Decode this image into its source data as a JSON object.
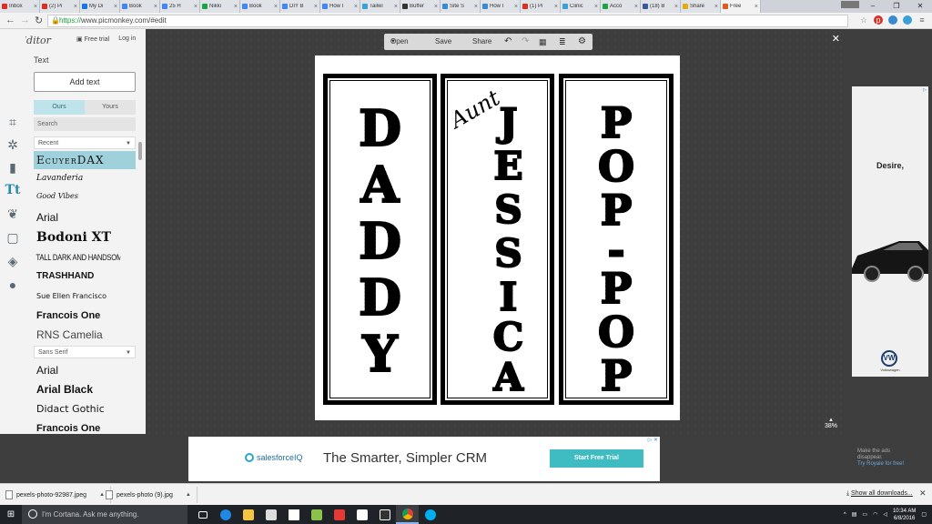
{
  "browser": {
    "tabs": [
      {
        "label": "Inbox",
        "color": "#d93025"
      },
      {
        "label": "(2) Pi",
        "color": "#d93025"
      },
      {
        "label": "My Di",
        "color": "#1a73e8"
      },
      {
        "label": "Book",
        "color": "#4285f4"
      },
      {
        "label": "25 H",
        "color": "#4285f4"
      },
      {
        "label": "Nikki",
        "color": "#1ea446"
      },
      {
        "label": "Book",
        "color": "#4285f4"
      },
      {
        "label": "DIY B",
        "color": "#4285f4"
      },
      {
        "label": "How I",
        "color": "#4285f4"
      },
      {
        "label": "Tailwi",
        "color": "#3aa0d5"
      },
      {
        "label": "Buffer",
        "color": "#333333"
      },
      {
        "label": "Site S",
        "color": "#3a8ad0"
      },
      {
        "label": "How I",
        "color": "#3a8ad0"
      },
      {
        "label": "(1) Pi",
        "color": "#d93025"
      },
      {
        "label": "Clinic",
        "color": "#3aa0d5"
      },
      {
        "label": "Acco",
        "color": "#1ea446"
      },
      {
        "label": "(18) B",
        "color": "#3b5998"
      },
      {
        "label": "Share",
        "color": "#e6a817"
      },
      {
        "label": "Free",
        "color": "#e05a1f"
      }
    ],
    "url_proto": "https://",
    "url_rest": "www.picmonkey.com/#edit",
    "window_min": "–",
    "window_max": "❐",
    "window_close": "✕"
  },
  "editor": {
    "logo_text": "Editor",
    "free_trial": "Free trial",
    "log_in": "Log in",
    "panel_title": "Text",
    "add_text": "Add text",
    "tab_ours": "Ours",
    "tab_yours": "Yours",
    "search_placeholder": "Search",
    "recent_label": "Recent",
    "sans_serif_label": "Sans Serif",
    "recent_fonts": [
      "EcuyerDAX",
      "Lavanderia",
      "Good Vibes",
      "Arial",
      "Bodoni XT",
      "Tall Dark and Handsome",
      "Trashhand",
      "Sue Ellen Francisco",
      "Francois One",
      "RNS Camelia"
    ],
    "sans_fonts": [
      "Arial",
      "Arial Black",
      "Didact Gothic",
      "Francois One"
    ]
  },
  "toolbar": {
    "open": "Open",
    "save": "Save",
    "share": "Share"
  },
  "canvas": {
    "zoom": "38%",
    "banner1_letters": [
      "D",
      "A",
      "D",
      "D",
      "Y"
    ],
    "banner2_script": "Aunt",
    "banner2_letters": [
      "J",
      "E",
      "S",
      "S",
      "I",
      "C",
      "A"
    ],
    "banner3_letters": [
      "P",
      "O",
      "P",
      "-",
      "P",
      "O",
      "P"
    ]
  },
  "ads": {
    "right_word": "Desire,",
    "right_brand": "Volkswagen",
    "bottom_brand": "salesforceIQ",
    "bottom_headline": "The Smarter, Simpler CRM",
    "bottom_cta": "Start Free Trial",
    "noads_line1": "Make the ads",
    "noads_line2": "disappear.",
    "noads_link": "Try Royale for free!"
  },
  "downloads": {
    "items": [
      "pexels-photo-92987.jpeg",
      "pexels-photo (9).jpg"
    ],
    "show_all": "Show all downloads..."
  },
  "taskbar": {
    "cortana": "I'm Cortana. Ask me anything.",
    "time": "10:34 AM",
    "date": "6/8/2016"
  }
}
